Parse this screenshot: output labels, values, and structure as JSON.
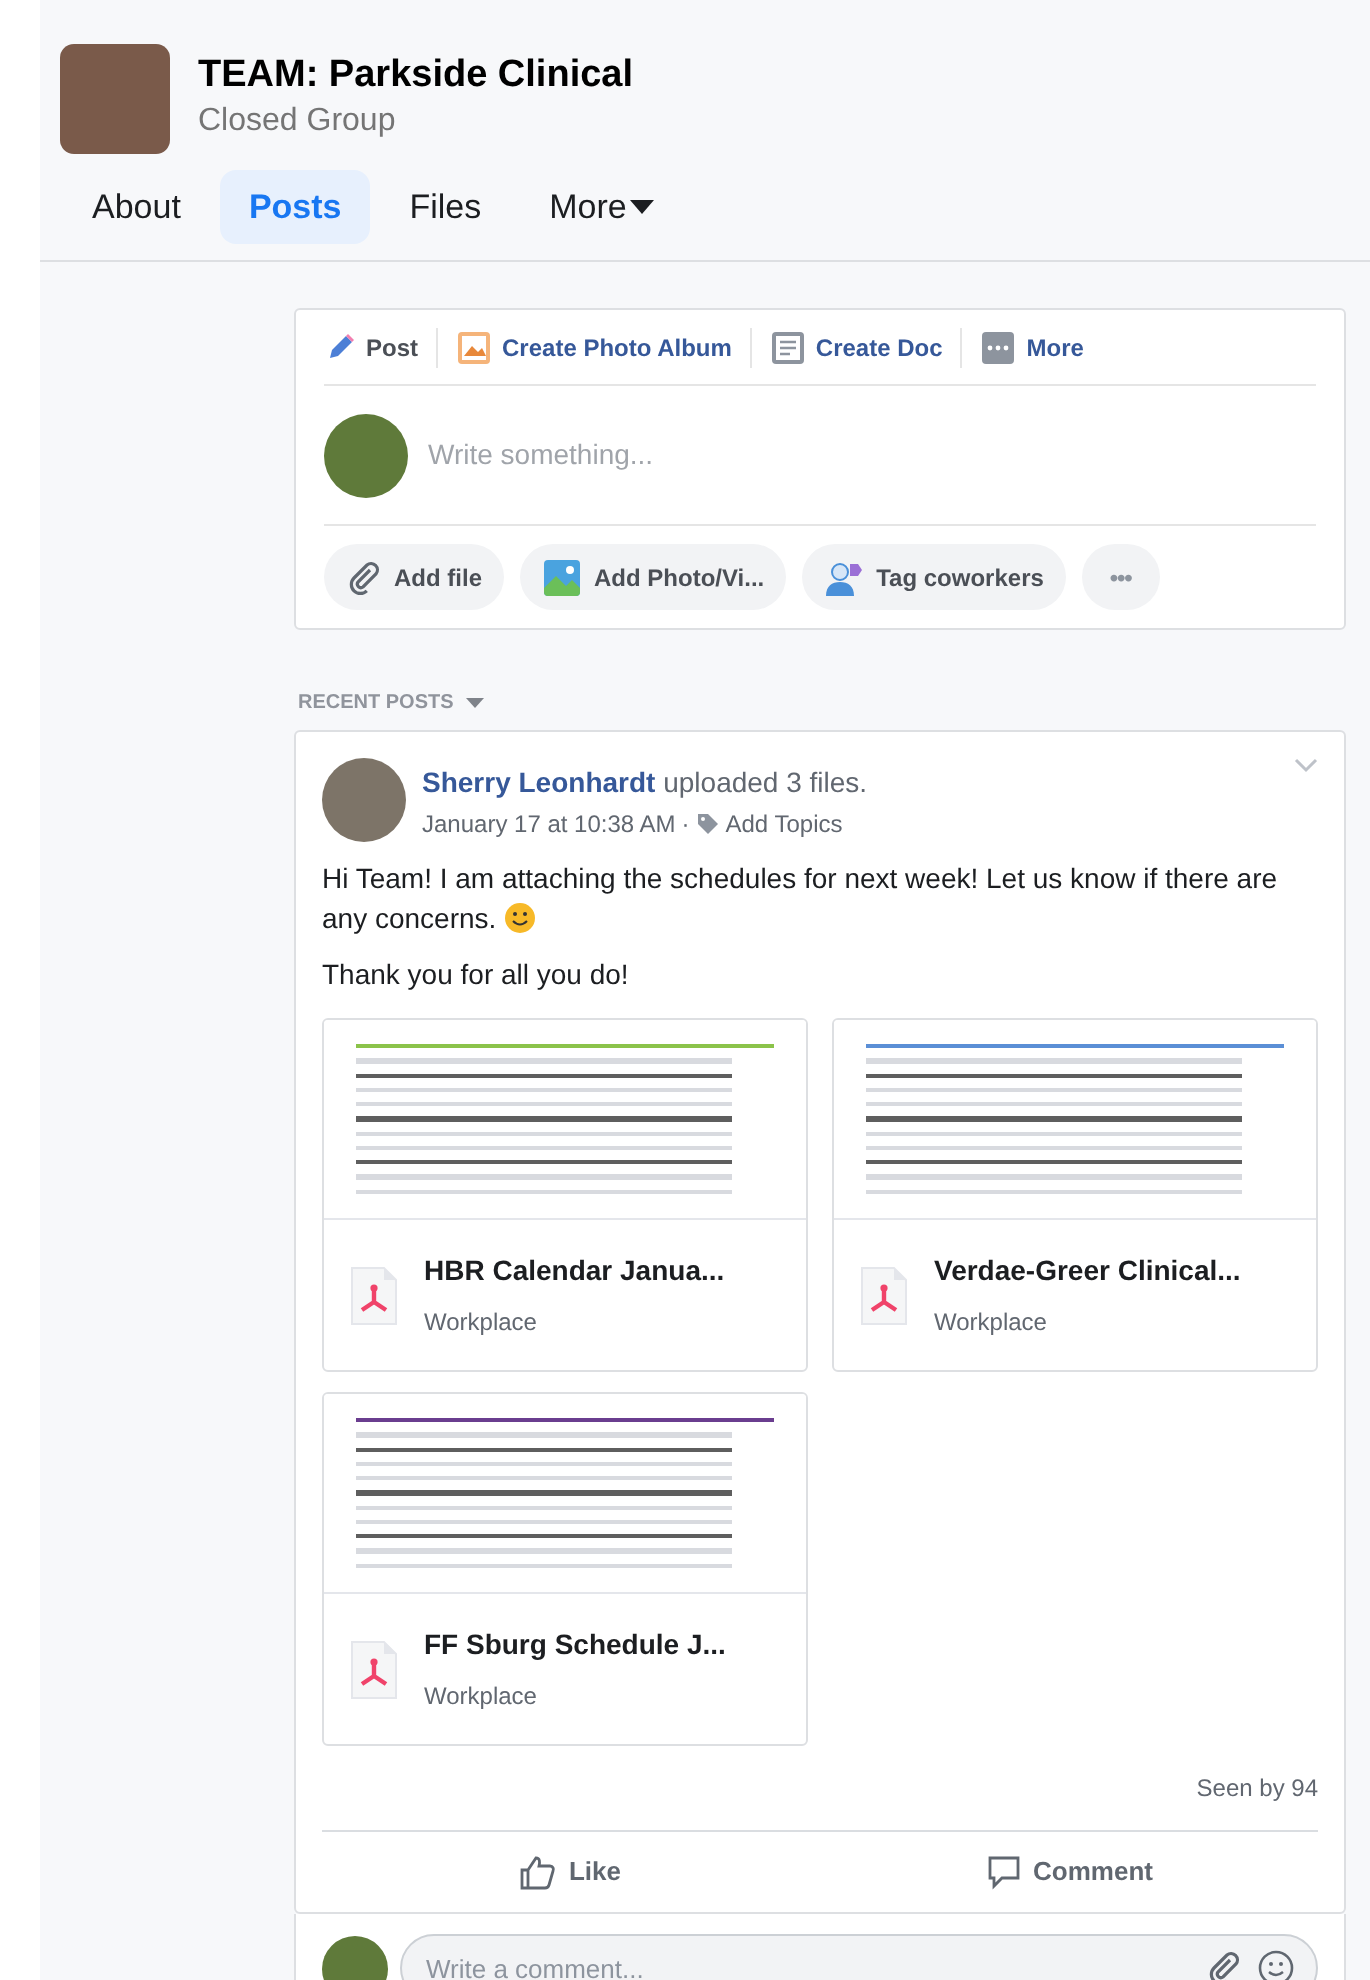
{
  "group": {
    "title": "TEAM: Parkside Clinical",
    "subtitle": "Closed Group"
  },
  "nav_tabs": [
    {
      "label": "About",
      "selected": false
    },
    {
      "label": "Posts",
      "selected": true
    },
    {
      "label": "Files",
      "selected": false
    },
    {
      "label": "More",
      "selected": false
    }
  ],
  "composer": {
    "tabs": [
      {
        "label": "Post",
        "kind": "post",
        "selected": true
      },
      {
        "label": "Create Photo Album",
        "kind": "album",
        "selected": false
      },
      {
        "label": "Create Doc",
        "kind": "doc",
        "selected": false
      },
      {
        "label": "More",
        "kind": "more",
        "selected": false
      }
    ],
    "placeholder": "Write something...",
    "actions": [
      {
        "label": "Add file",
        "kind": "file"
      },
      {
        "label": "Add Photo/Vi...",
        "kind": "photo"
      },
      {
        "label": "Tag coworkers",
        "kind": "tag"
      },
      {
        "label": "•••",
        "kind": "overflow"
      }
    ]
  },
  "recent_posts_label": "RECENT POSTS",
  "post": {
    "author": "Sherry Leonhardt",
    "action": "uploaded 3 files.",
    "time": "January 17 at 10:38 AM",
    "separator": "·",
    "topics": "Add Topics",
    "body": [
      "Hi Team! I am attaching the schedules for next week! Let us know if there are any concerns.",
      "Thank you for all you do!"
    ],
    "files": [
      {
        "name": "HBR Calendar Janua...",
        "source": "Workplace"
      },
      {
        "name": "Verdae-Greer Clinical...",
        "source": "Workplace"
      },
      {
        "name": "FF Sburg Schedule J...",
        "source": "Workplace"
      }
    ],
    "seen": "Seen by 94",
    "reactions": [
      {
        "label": "Like",
        "kind": "like"
      },
      {
        "label": "Comment",
        "kind": "comment"
      }
    ],
    "comment_placeholder": "Write a comment..."
  }
}
